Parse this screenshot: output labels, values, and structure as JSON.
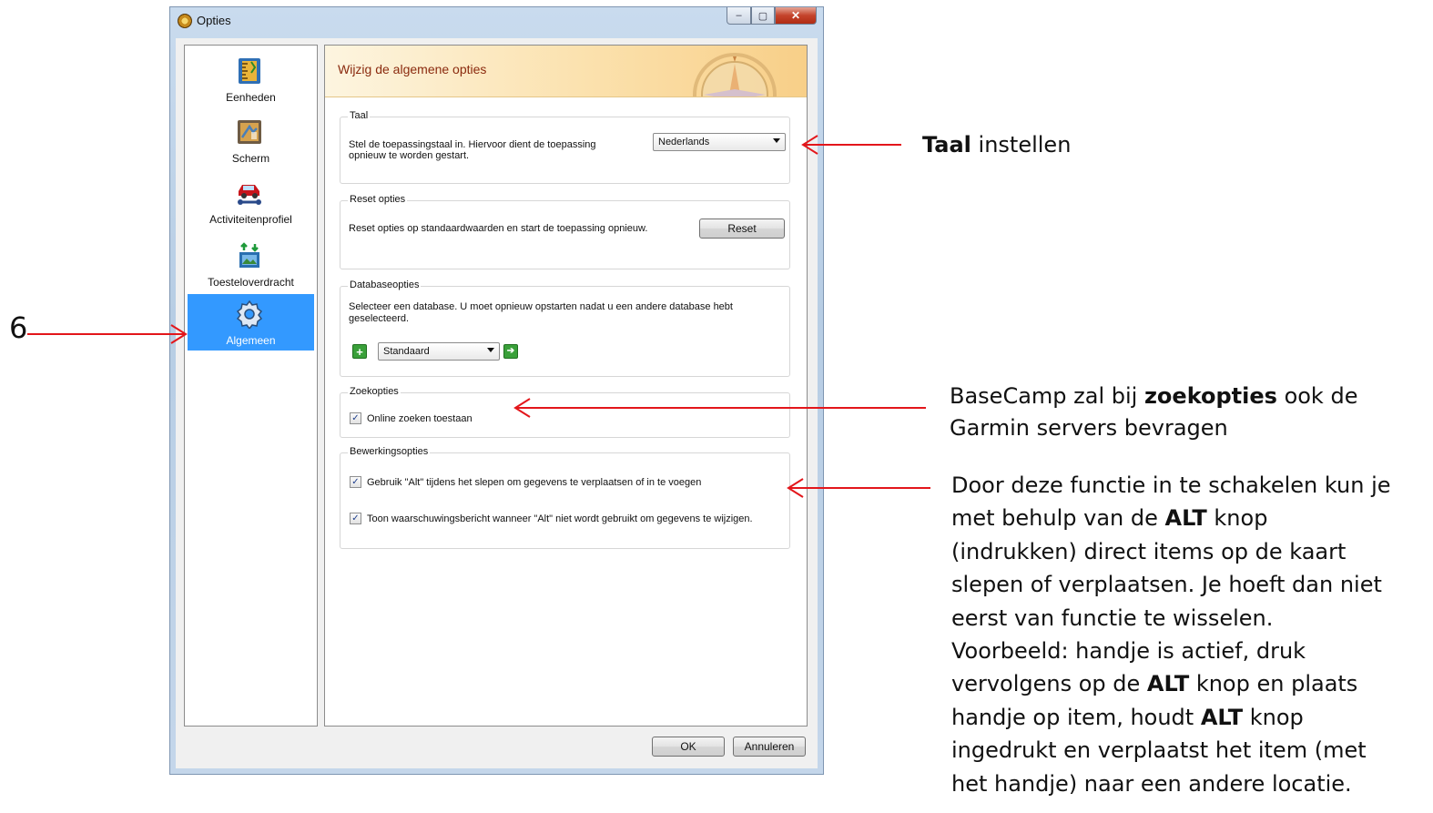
{
  "window": {
    "title": "Opties",
    "controls": {
      "minimize": "‒",
      "maximize": "▢",
      "close": "✕"
    }
  },
  "sidebar": {
    "items": [
      {
        "label": "Eenheden",
        "icon": "ruler-icon",
        "selected": false
      },
      {
        "label": "Scherm",
        "icon": "display-icon",
        "selected": false
      },
      {
        "label": "Activiteitenprofiel",
        "icon": "car-wrench-icon",
        "selected": false
      },
      {
        "label": "Toesteloverdracht",
        "icon": "device-transfer-icon",
        "selected": false
      },
      {
        "label": "Algemeen",
        "icon": "gear-icon",
        "selected": true
      }
    ]
  },
  "content": {
    "header": "Wijzig de algemene opties",
    "taal": {
      "title": "Taal",
      "description_line1": "Stel de toepassingstaal in. Hiervoor dient de toepassing",
      "description_line2": "opnieuw te worden gestart.",
      "selected": "Nederlands"
    },
    "reset": {
      "title": "Reset opties",
      "description": "Reset opties op standaardwaarden en start de toepassing opnieuw.",
      "button": "Reset"
    },
    "database": {
      "title": "Databaseopties",
      "description_line1": "Selecteer een database.  U moet opnieuw opstarten nadat u een andere database hebt",
      "description_line2": "geselecteerd.",
      "selected": "Standaard",
      "add_label": "+",
      "go_label": "➔"
    },
    "zoek": {
      "title": "Zoekopties",
      "online_search": {
        "label": "Online zoeken toestaan",
        "checked": true
      }
    },
    "bewerking": {
      "title": "Bewerkingsopties",
      "use_alt": {
        "label": "Gebruik \"Alt\" tijdens het slepen om gegevens te verplaatsen of in te voegen",
        "checked": true
      },
      "warn_alt": {
        "label": "Toon waarschuwingsbericht wanneer \"Alt\" niet wordt gebruikt om gegevens te wijzigen.",
        "checked": true
      }
    }
  },
  "footer": {
    "ok": "OK",
    "cancel": "Annuleren"
  },
  "checkmark": "✓",
  "annotations": {
    "number": "6",
    "taal_bold": "Taal",
    "taal_rest": " instellen",
    "zoek_line1_a": "BaseCamp zal bij ",
    "zoek_line1_bold": "zoekopties",
    "zoek_line1_b": " ook de",
    "zoek_line2": "Garmin servers bevragen",
    "alt_l1": "Door deze functie in te schakelen kun je",
    "alt_l2_a": "met behulp van de ",
    "alt_l2_bold": "ALT",
    "alt_l2_b": " knop",
    "alt_l3": "(indrukken) direct items op de kaart",
    "alt_l4": "slepen of verplaatsen. Je hoeft dan niet",
    "alt_l5": "eerst van functie te wisselen.",
    "alt_l6": "Voorbeeld: handje is actief, druk",
    "alt_l7_a": "vervolgens op de ",
    "alt_l7_bold": "ALT",
    "alt_l7_b": " knop en plaats",
    "alt_l8_a": "handje op item, houdt ",
    "alt_l8_bold": "ALT",
    "alt_l8_b": " knop",
    "alt_l9": "ingedrukt en verplaatst het item (met",
    "alt_l10": "het handje) naar een andere locatie."
  },
  "colors": {
    "arrow": "#e3161b",
    "selection": "#3399ff",
    "header_text": "#8a2a0e"
  }
}
